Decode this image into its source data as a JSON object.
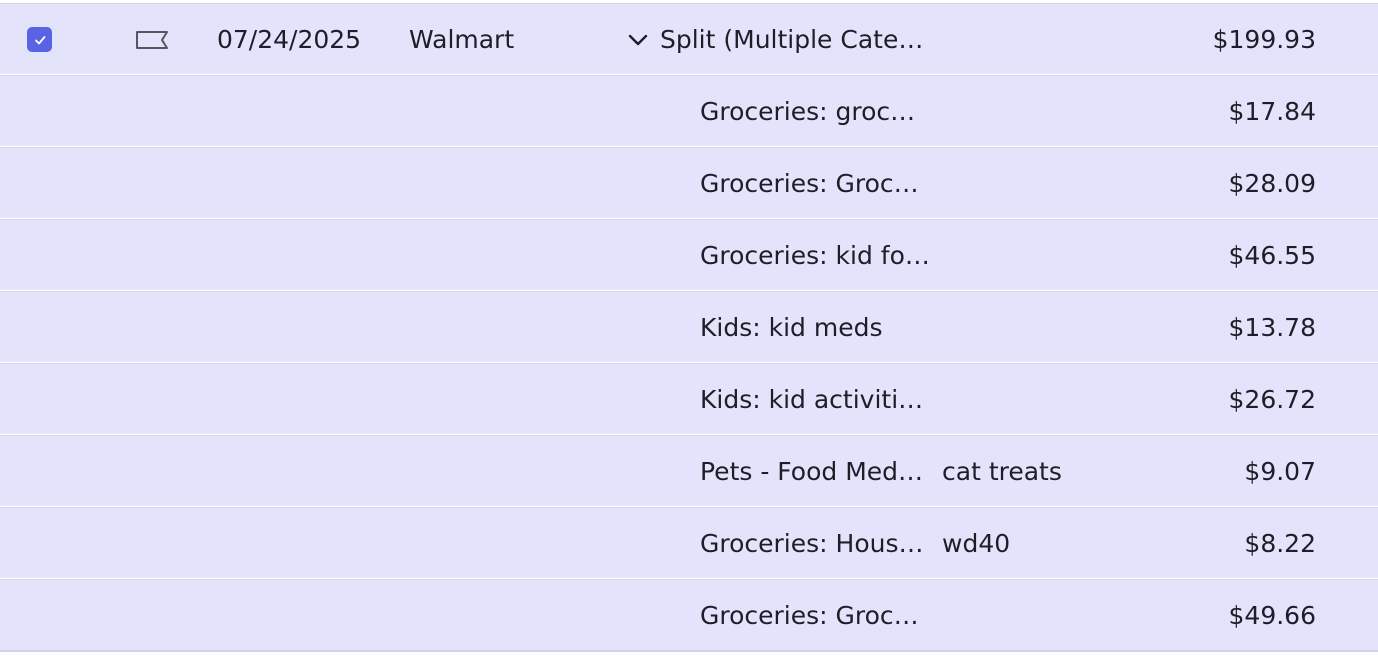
{
  "transaction": {
    "checked": true,
    "date": "07/24/2025",
    "merchant": "Walmart",
    "category_label": "Split (Multiple Cate…",
    "amount": "$199.93"
  },
  "splits": [
    {
      "category": "Groceries: groc…",
      "note": "",
      "amount": "$17.84"
    },
    {
      "category": "Groceries: Groc…",
      "note": "",
      "amount": "$28.09"
    },
    {
      "category": "Groceries: kid fo…",
      "note": "",
      "amount": "$46.55"
    },
    {
      "category": "Kids: kid meds",
      "note": "",
      "amount": "$13.78"
    },
    {
      "category": "Kids: kid activiti…",
      "note": "",
      "amount": "$26.72"
    },
    {
      "category": "Pets - Food Med…",
      "note": "cat treats",
      "amount": "$9.07"
    },
    {
      "category": "Groceries: Hous…",
      "note": "wd40",
      "amount": "$8.22"
    },
    {
      "category": "Groceries: Groc…",
      "note": "",
      "amount": "$49.66"
    }
  ],
  "colors": {
    "row_bg": "#e3e4fb",
    "divider": "#d2d3e6",
    "checkbox_accent": "#5a63e6",
    "text": "#1e1e28"
  },
  "icons": {
    "checkbox": "checkmark-icon",
    "flag": "flag-icon",
    "expand": "chevron-down-icon"
  }
}
